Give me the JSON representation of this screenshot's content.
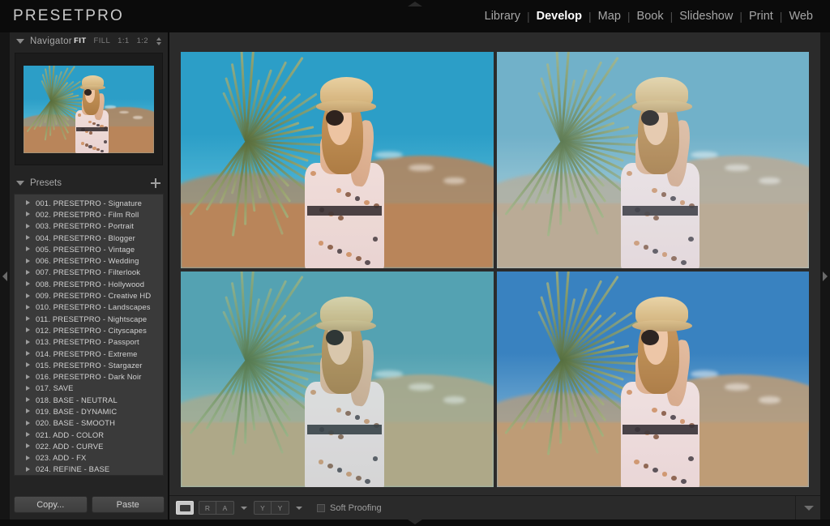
{
  "app": {
    "brand": "PRESETPRO"
  },
  "modules": {
    "separator": "|",
    "items": [
      {
        "label": "Library",
        "active": false
      },
      {
        "label": "Develop",
        "active": true
      },
      {
        "label": "Map",
        "active": false
      },
      {
        "label": "Book",
        "active": false
      },
      {
        "label": "Slideshow",
        "active": false
      },
      {
        "label": "Print",
        "active": false
      },
      {
        "label": "Web",
        "active": false
      }
    ]
  },
  "navigator": {
    "title": "Navigator",
    "zoom_levels": [
      {
        "label": "FIT",
        "active": true
      },
      {
        "label": "FILL",
        "active": false
      },
      {
        "label": "1:1",
        "active": false
      },
      {
        "label": "1:2",
        "active": false
      }
    ]
  },
  "presets": {
    "title": "Presets",
    "add_icon": "plus-icon",
    "items": [
      "001. PRESETPRO - Signature",
      "002. PRESETPRO - Film Roll",
      "003. PRESETPRO - Portrait",
      "004. PRESETPRO - Blogger",
      "005. PRESETPRO - Vintage",
      "006. PRESETPRO - Wedding",
      "007. PRESETPRO - Filterlook",
      "008. PRESETPRO - Hollywood",
      "009. PRESETPRO - Creative HD",
      "010. PRESETPRO - Landscapes",
      "011. PRESETPRO - Nightscape",
      "012. PRESETPRO - Cityscapes",
      "013. PRESETPRO - Passport",
      "014. PRESETPRO - Extreme",
      "015. PRESETPRO - Stargazer",
      "016. PRESETPRO - Dark Noir",
      "017. SAVE",
      "018. BASE - NEUTRAL",
      "019. BASE - DYNAMIC",
      "020. BASE - SMOOTH",
      "021. ADD - COLOR",
      "022. ADD - CURVE",
      "023. ADD - FX",
      "024. REFINE - BASE"
    ]
  },
  "actions": {
    "copy_label": "Copy...",
    "paste_label": "Paste"
  },
  "toolbar": {
    "loupe_view": "loupe-view-icon",
    "before_after_label": "R A",
    "before_after_split_label": "Y Y",
    "soft_proofing_label": "Soft Proofing",
    "soft_proofing_checked": false,
    "right_chevron": "chevron-down-icon"
  },
  "canvas": {
    "view_mode": "survey",
    "cells": [
      {
        "name": "variant-top-left",
        "sky": "#1f9fd0",
        "sky2": "#54c2e4",
        "ground": "#b5845c",
        "grade": "rgba(255,150,60,0.06)"
      },
      {
        "name": "variant-top-right",
        "sky": "#63a9c4",
        "sky2": "#9fc9d6",
        "ground": "#b8a289",
        "grade": "rgba(200,225,235,0.14)"
      },
      {
        "name": "variant-bottom-left",
        "sky": "#4e9bb0",
        "sky2": "#8dc0c4",
        "ground": "#b9a37e",
        "grade": "rgba(120,200,190,0.16)"
      },
      {
        "name": "variant-bottom-right",
        "sky": "#2f7fc2",
        "sky2": "#79b4da",
        "ground": "#bb9a74",
        "grade": "rgba(255,190,150,0.05)"
      }
    ]
  },
  "edges": {
    "left_toggle": "panel-collapse-left-icon",
    "right_toggle": "panel-collapse-right-icon",
    "top_toggle": "panel-collapse-top-icon",
    "bottom_toggle": "panel-collapse-bottom-icon"
  }
}
